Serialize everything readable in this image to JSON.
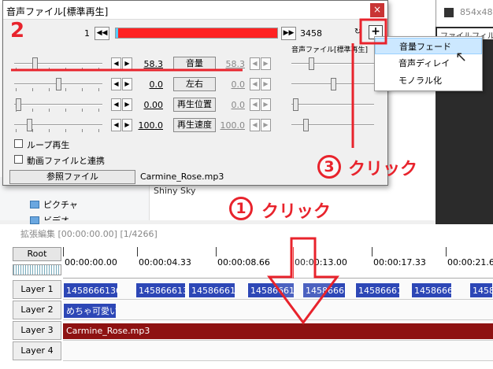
{
  "explorer": {
    "items": [
      {
        "label": "ピクチャ",
        "icon": "pictures-folder-icon"
      },
      {
        "label": "ビデオ",
        "icon": "videos-folder-icon"
      }
    ],
    "file_label": "Shiny Sky"
  },
  "video_window": {
    "size_text": "854x480",
    "menu_file": "ファイル",
    "menu_filter": "フィル"
  },
  "dialog": {
    "title": "音声ファイル[標準再生]",
    "frame_start": "1",
    "frame_end": "3458",
    "subtitle": "音声ファイル[標準再生]",
    "params": [
      {
        "left_value": "58.3",
        "label": "音量",
        "right_value": "58.3",
        "slider_pos": 0.22
      },
      {
        "left_value": "0.0",
        "label": "左右",
        "right_value": "0.0",
        "slider_pos": 0.5
      },
      {
        "left_value": "0.00",
        "label": "再生位置",
        "right_value": "0.0",
        "slider_pos": 0.02
      },
      {
        "left_value": "100.0",
        "label": "再生速度",
        "right_value": "100.0",
        "slider_pos": 0.15
      }
    ],
    "loop_label": "ループ再生",
    "link_label": "動画ファイルと連携",
    "ref_button": "参照ファイル",
    "ref_file": "Carmine_Rose.mp3",
    "plus_label": "+"
  },
  "popup_menu": {
    "items": [
      "音量フェード",
      "音声ディレイ",
      "モノラル化"
    ],
    "highlighted": 0
  },
  "timeline": {
    "title": "拡張編集 [00:00:00.00] [1/4266]",
    "root_label": "Root",
    "ruler": [
      "00:00:00.00",
      "00:00:04.33",
      "00:00:08.66",
      "00:00:13.00",
      "00:00:17.33",
      "00:00:21.66"
    ],
    "layers": [
      "Layer 1",
      "Layer 2",
      "Layer 3",
      "Layer 4"
    ],
    "layer1_clips": [
      "1458666136",
      "145866613",
      "145866613",
      "145866613",
      "145866613",
      "145866613",
      "145866613",
      "14586"
    ],
    "layer2_clip": "めちゃ可愛い",
    "layer3_clip": "Carmine_Rose.mp3"
  },
  "annotations": {
    "step1_num": "1",
    "step1_text": "クリック",
    "step2_num": "2",
    "step3_num": "3",
    "step3_text": "クリック",
    "accent": "#e8232c"
  }
}
